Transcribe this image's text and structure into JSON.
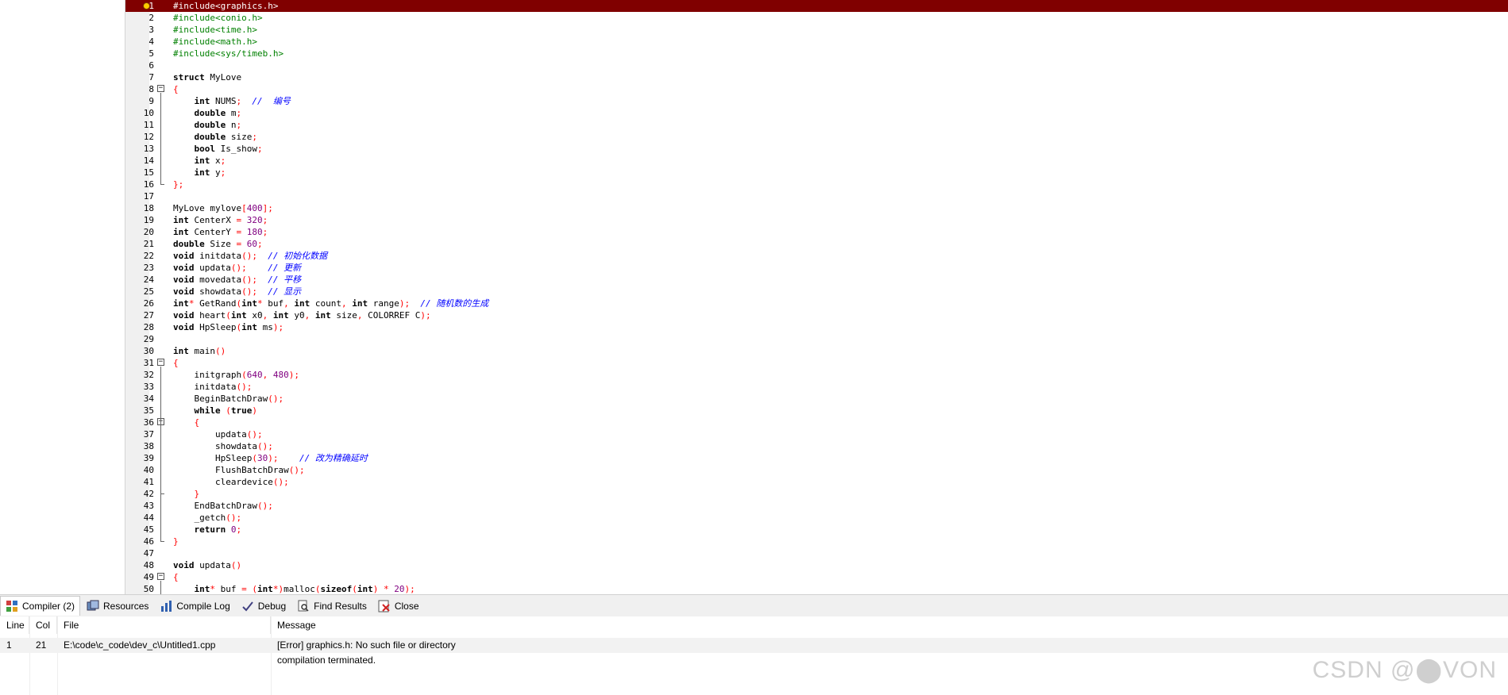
{
  "editor": {
    "lines": [
      {
        "n": "1",
        "error": true,
        "tokens": [
          {
            "t": "#include<graphics.h>",
            "c": "pp"
          }
        ]
      },
      {
        "n": "2",
        "tokens": [
          {
            "t": "#include<conio.h>",
            "c": "pp"
          }
        ]
      },
      {
        "n": "3",
        "tokens": [
          {
            "t": "#include<time.h>",
            "c": "pp"
          }
        ]
      },
      {
        "n": "4",
        "tokens": [
          {
            "t": "#include<math.h>",
            "c": "pp"
          }
        ]
      },
      {
        "n": "5",
        "tokens": [
          {
            "t": "#include<sys/timeb.h>",
            "c": "pp"
          }
        ]
      },
      {
        "n": "6",
        "tokens": []
      },
      {
        "n": "7",
        "tokens": [
          {
            "t": "struct",
            "c": "kw"
          },
          {
            "t": " MyLove",
            "c": "id"
          }
        ]
      },
      {
        "n": "8",
        "fold": "start",
        "tokens": [
          {
            "t": "{",
            "c": "sym"
          }
        ]
      },
      {
        "n": "9",
        "tokens": [
          {
            "t": "    int",
            "c": "kw"
          },
          {
            "t": " NUMS",
            "c": "id"
          },
          {
            "t": ";",
            "c": "sym"
          },
          {
            "t": "  //  编号",
            "c": "cm"
          }
        ]
      },
      {
        "n": "10",
        "tokens": [
          {
            "t": "    double",
            "c": "kw"
          },
          {
            "t": " m",
            "c": "id"
          },
          {
            "t": ";",
            "c": "sym"
          }
        ]
      },
      {
        "n": "11",
        "tokens": [
          {
            "t": "    double",
            "c": "kw"
          },
          {
            "t": " n",
            "c": "id"
          },
          {
            "t": ";",
            "c": "sym"
          }
        ]
      },
      {
        "n": "12",
        "tokens": [
          {
            "t": "    double",
            "c": "kw"
          },
          {
            "t": " size",
            "c": "id"
          },
          {
            "t": ";",
            "c": "sym"
          }
        ]
      },
      {
        "n": "13",
        "tokens": [
          {
            "t": "    bool",
            "c": "kw"
          },
          {
            "t": " Is_show",
            "c": "id"
          },
          {
            "t": ";",
            "c": "sym"
          }
        ]
      },
      {
        "n": "14",
        "tokens": [
          {
            "t": "    int",
            "c": "kw"
          },
          {
            "t": " x",
            "c": "id"
          },
          {
            "t": ";",
            "c": "sym"
          }
        ]
      },
      {
        "n": "15",
        "tokens": [
          {
            "t": "    int",
            "c": "kw"
          },
          {
            "t": " y",
            "c": "id"
          },
          {
            "t": ";",
            "c": "sym"
          }
        ]
      },
      {
        "n": "16",
        "fold": "end",
        "tokens": [
          {
            "t": "};",
            "c": "sym"
          }
        ]
      },
      {
        "n": "17",
        "tokens": []
      },
      {
        "n": "18",
        "tokens": [
          {
            "t": "MyLove mylove",
            "c": "id"
          },
          {
            "t": "[",
            "c": "sym"
          },
          {
            "t": "400",
            "c": "num"
          },
          {
            "t": "];",
            "c": "sym"
          }
        ]
      },
      {
        "n": "19",
        "tokens": [
          {
            "t": "int",
            "c": "kw"
          },
          {
            "t": " CenterX ",
            "c": "id"
          },
          {
            "t": "=",
            "c": "sym"
          },
          {
            "t": " 320",
            "c": "num"
          },
          {
            "t": ";",
            "c": "sym"
          }
        ]
      },
      {
        "n": "20",
        "tokens": [
          {
            "t": "int",
            "c": "kw"
          },
          {
            "t": " CenterY ",
            "c": "id"
          },
          {
            "t": "=",
            "c": "sym"
          },
          {
            "t": " 180",
            "c": "num"
          },
          {
            "t": ";",
            "c": "sym"
          }
        ]
      },
      {
        "n": "21",
        "tokens": [
          {
            "t": "double",
            "c": "kw"
          },
          {
            "t": " Size ",
            "c": "id"
          },
          {
            "t": "=",
            "c": "sym"
          },
          {
            "t": " 60",
            "c": "num"
          },
          {
            "t": ";",
            "c": "sym"
          }
        ]
      },
      {
        "n": "22",
        "tokens": [
          {
            "t": "void",
            "c": "kw"
          },
          {
            "t": " initdata",
            "c": "id"
          },
          {
            "t": "();",
            "c": "sym"
          },
          {
            "t": "  // 初始化数据",
            "c": "cm"
          }
        ]
      },
      {
        "n": "23",
        "tokens": [
          {
            "t": "void",
            "c": "kw"
          },
          {
            "t": " updata",
            "c": "id"
          },
          {
            "t": "();",
            "c": "sym"
          },
          {
            "t": "    // 更新",
            "c": "cm"
          }
        ]
      },
      {
        "n": "24",
        "tokens": [
          {
            "t": "void",
            "c": "kw"
          },
          {
            "t": " movedata",
            "c": "id"
          },
          {
            "t": "();",
            "c": "sym"
          },
          {
            "t": "  // 平移",
            "c": "cm"
          }
        ]
      },
      {
        "n": "25",
        "tokens": [
          {
            "t": "void",
            "c": "kw"
          },
          {
            "t": " showdata",
            "c": "id"
          },
          {
            "t": "();",
            "c": "sym"
          },
          {
            "t": "  // 显示",
            "c": "cm"
          }
        ]
      },
      {
        "n": "26",
        "tokens": [
          {
            "t": "int",
            "c": "kw"
          },
          {
            "t": "*",
            "c": "sym"
          },
          {
            "t": " GetRand",
            "c": "id"
          },
          {
            "t": "(",
            "c": "sym"
          },
          {
            "t": "int",
            "c": "kw"
          },
          {
            "t": "*",
            "c": "sym"
          },
          {
            "t": " buf",
            "c": "id"
          },
          {
            "t": ",",
            "c": "sym"
          },
          {
            "t": " int",
            "c": "kw"
          },
          {
            "t": " count",
            "c": "id"
          },
          {
            "t": ",",
            "c": "sym"
          },
          {
            "t": " int",
            "c": "kw"
          },
          {
            "t": " range",
            "c": "id"
          },
          {
            "t": ");",
            "c": "sym"
          },
          {
            "t": "  // 随机数的生成",
            "c": "cm"
          }
        ]
      },
      {
        "n": "27",
        "tokens": [
          {
            "t": "void",
            "c": "kw"
          },
          {
            "t": " heart",
            "c": "id"
          },
          {
            "t": "(",
            "c": "sym"
          },
          {
            "t": "int",
            "c": "kw"
          },
          {
            "t": " x0",
            "c": "id"
          },
          {
            "t": ",",
            "c": "sym"
          },
          {
            "t": " int",
            "c": "kw"
          },
          {
            "t": " y0",
            "c": "id"
          },
          {
            "t": ",",
            "c": "sym"
          },
          {
            "t": " int",
            "c": "kw"
          },
          {
            "t": " size",
            "c": "id"
          },
          {
            "t": ",",
            "c": "sym"
          },
          {
            "t": " COLORREF C",
            "c": "id"
          },
          {
            "t": ");",
            "c": "sym"
          }
        ]
      },
      {
        "n": "28",
        "tokens": [
          {
            "t": "void",
            "c": "kw"
          },
          {
            "t": " HpSleep",
            "c": "id"
          },
          {
            "t": "(",
            "c": "sym"
          },
          {
            "t": "int",
            "c": "kw"
          },
          {
            "t": " ms",
            "c": "id"
          },
          {
            "t": ");",
            "c": "sym"
          }
        ]
      },
      {
        "n": "29",
        "tokens": []
      },
      {
        "n": "30",
        "tokens": [
          {
            "t": "int",
            "c": "kw"
          },
          {
            "t": " main",
            "c": "id"
          },
          {
            "t": "()",
            "c": "sym"
          }
        ]
      },
      {
        "n": "31",
        "fold": "start",
        "tokens": [
          {
            "t": "{",
            "c": "sym"
          }
        ]
      },
      {
        "n": "32",
        "tokens": [
          {
            "t": "    initgraph",
            "c": "id"
          },
          {
            "t": "(",
            "c": "sym"
          },
          {
            "t": "640",
            "c": "num"
          },
          {
            "t": ",",
            "c": "sym"
          },
          {
            "t": " 480",
            "c": "num"
          },
          {
            "t": ");",
            "c": "sym"
          }
        ]
      },
      {
        "n": "33",
        "tokens": [
          {
            "t": "    initdata",
            "c": "id"
          },
          {
            "t": "();",
            "c": "sym"
          }
        ]
      },
      {
        "n": "34",
        "tokens": [
          {
            "t": "    BeginBatchDraw",
            "c": "id"
          },
          {
            "t": "();",
            "c": "sym"
          }
        ]
      },
      {
        "n": "35",
        "tokens": [
          {
            "t": "    while",
            "c": "kw"
          },
          {
            "t": " (",
            "c": "sym"
          },
          {
            "t": "true",
            "c": "kw"
          },
          {
            "t": ")",
            "c": "sym"
          }
        ]
      },
      {
        "n": "36",
        "fold": "start2",
        "tokens": [
          {
            "t": "    {",
            "c": "sym"
          }
        ]
      },
      {
        "n": "37",
        "tokens": [
          {
            "t": "        updata",
            "c": "id"
          },
          {
            "t": "();",
            "c": "sym"
          }
        ]
      },
      {
        "n": "38",
        "tokens": [
          {
            "t": "        showdata",
            "c": "id"
          },
          {
            "t": "();",
            "c": "sym"
          }
        ]
      },
      {
        "n": "39",
        "tokens": [
          {
            "t": "        HpSleep",
            "c": "id"
          },
          {
            "t": "(",
            "c": "sym"
          },
          {
            "t": "30",
            "c": "num"
          },
          {
            "t": ");",
            "c": "sym"
          },
          {
            "t": "    // 改为精确延时",
            "c": "cm"
          }
        ]
      },
      {
        "n": "40",
        "tokens": [
          {
            "t": "        FlushBatchDraw",
            "c": "id"
          },
          {
            "t": "();",
            "c": "sym"
          }
        ]
      },
      {
        "n": "41",
        "tokens": [
          {
            "t": "        cleardevice",
            "c": "id"
          },
          {
            "t": "();",
            "c": "sym"
          }
        ]
      },
      {
        "n": "42",
        "fold": "end2",
        "tokens": [
          {
            "t": "    }",
            "c": "sym"
          }
        ]
      },
      {
        "n": "43",
        "tokens": [
          {
            "t": "    EndBatchDraw",
            "c": "id"
          },
          {
            "t": "();",
            "c": "sym"
          }
        ]
      },
      {
        "n": "44",
        "tokens": [
          {
            "t": "    _getch",
            "c": "id"
          },
          {
            "t": "();",
            "c": "sym"
          }
        ]
      },
      {
        "n": "45",
        "tokens": [
          {
            "t": "    return",
            "c": "kw"
          },
          {
            "t": " 0",
            "c": "num"
          },
          {
            "t": ";",
            "c": "sym"
          }
        ]
      },
      {
        "n": "46",
        "fold": "end",
        "tokens": [
          {
            "t": "}",
            "c": "sym"
          }
        ]
      },
      {
        "n": "47",
        "tokens": []
      },
      {
        "n": "48",
        "tokens": [
          {
            "t": "void",
            "c": "kw"
          },
          {
            "t": " updata",
            "c": "id"
          },
          {
            "t": "()",
            "c": "sym"
          }
        ]
      },
      {
        "n": "49",
        "fold": "start",
        "tokens": [
          {
            "t": "{",
            "c": "sym"
          }
        ]
      },
      {
        "n": "50",
        "tokens": [
          {
            "t": "    int",
            "c": "kw"
          },
          {
            "t": "*",
            "c": "sym"
          },
          {
            "t": " buf ",
            "c": "id"
          },
          {
            "t": "=",
            "c": "sym"
          },
          {
            "t": " (",
            "c": "sym"
          },
          {
            "t": "int",
            "c": "kw"
          },
          {
            "t": "*)",
            "c": "sym"
          },
          {
            "t": "malloc",
            "c": "id"
          },
          {
            "t": "(",
            "c": "sym"
          },
          {
            "t": "sizeof",
            "c": "kw"
          },
          {
            "t": "(",
            "c": "sym"
          },
          {
            "t": "int",
            "c": "kw"
          },
          {
            "t": ")",
            "c": "sym"
          },
          {
            "t": " * ",
            "c": "sym"
          },
          {
            "t": "20",
            "c": "num"
          },
          {
            "t": ");",
            "c": "sym"
          }
        ]
      }
    ]
  },
  "tabs": [
    {
      "label": "Compiler (2)",
      "icon": "grid-icon",
      "active": true
    },
    {
      "label": "Resources",
      "icon": "resources-icon"
    },
    {
      "label": "Compile Log",
      "icon": "chart-icon"
    },
    {
      "label": "Debug",
      "icon": "check-icon"
    },
    {
      "label": "Find Results",
      "icon": "find-icon"
    },
    {
      "label": "Close",
      "icon": "close-icon"
    }
  ],
  "messages": {
    "headers": {
      "line": "Line",
      "col": "Col",
      "file": "File",
      "message": "Message"
    },
    "rows": [
      {
        "line": "1",
        "col": "21",
        "file": "E:\\code\\c_code\\dev_c\\Untitled1.cpp",
        "message": "[Error] graphics.h: No such file or directory"
      },
      {
        "line": "",
        "col": "",
        "file": "",
        "message": "compilation terminated."
      }
    ]
  },
  "watermark": "CSDN @⬤VON",
  "colors": {
    "error_line": "#800000",
    "preprocessor": "#008000",
    "number": "#800080",
    "comment": "#0000ff",
    "symbol": "#ff0000"
  }
}
